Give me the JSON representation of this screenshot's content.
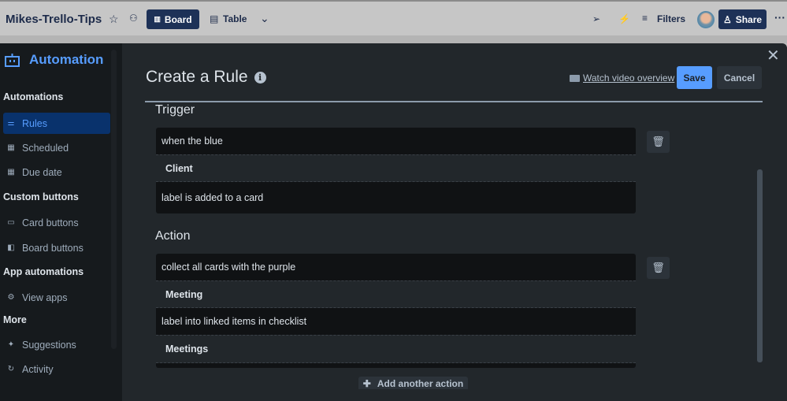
{
  "topbar": {
    "board_title": "Mikes-Trello-Tips",
    "board_view": "Board",
    "table_view": "Table",
    "filters": "Filters",
    "share": "Share"
  },
  "sidebar": {
    "title": "Automation",
    "sections": [
      {
        "label": "Automations",
        "items": [
          {
            "label": "Rules",
            "icon": "sliders-icon"
          },
          {
            "label": "Scheduled",
            "icon": "calendar-icon"
          },
          {
            "label": "Due date",
            "icon": "calendar-icon"
          }
        ]
      },
      {
        "label": "Custom buttons",
        "items": [
          {
            "label": "Card buttons",
            "icon": "card-icon"
          },
          {
            "label": "Board buttons",
            "icon": "board-icon"
          }
        ]
      },
      {
        "label": "App automations",
        "items": [
          {
            "label": "View apps",
            "icon": "gear-icon"
          }
        ]
      },
      {
        "label": "More",
        "items": [
          {
            "label": "Suggestions",
            "icon": "sparkle-icon"
          },
          {
            "label": "Activity",
            "icon": "refresh-icon"
          }
        ]
      }
    ]
  },
  "main": {
    "title": "Create a Rule",
    "watch": "Watch video overview",
    "save": "Save",
    "cancel": "Cancel",
    "trigger": {
      "heading": "Trigger",
      "parts": [
        "when the blue",
        "Client",
        "label is added to a card"
      ]
    },
    "action": {
      "heading": "Action",
      "parts": [
        "collect all cards with the purple",
        "Meeting",
        "label into linked items in checklist",
        "Meetings"
      ]
    },
    "add_action": "Add another action"
  }
}
